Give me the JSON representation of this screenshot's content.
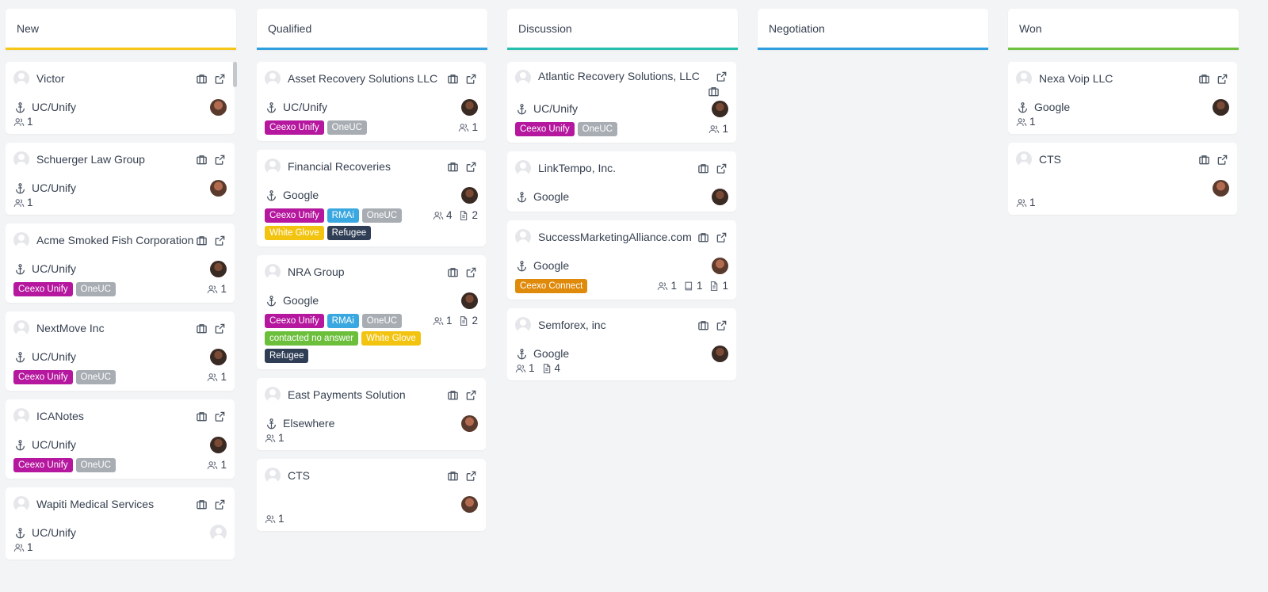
{
  "colors": {
    "new": "#f5c518",
    "qualified": "#2f9fe0",
    "discussion": "#26bfae",
    "negotiation": "#2f9fe0",
    "won": "#6fc13f"
  },
  "tag_colors": {
    "Ceexo Unify": "#b5179e",
    "OneUC": "#a8adb3",
    "RMAi": "#3aa8e0",
    "White Glove": "#f2c30f",
    "Refugee": "#2f3e55",
    "contacted no answer": "#6cbf3b",
    "Ceexo Connect": "#e08a0b"
  },
  "columns": [
    {
      "key": "new",
      "title": "New",
      "cards": [
        {
          "name": "Victor",
          "source": "UC/Unify",
          "owner": "light",
          "tags": [],
          "counts": [
            {
              "icon": "users-icon",
              "value": "1"
            }
          ],
          "counts_inline": true
        },
        {
          "name": "Schuerger Law Group",
          "source": "UC/Unify",
          "owner": "light",
          "tags": [],
          "counts": [
            {
              "icon": "users-icon",
              "value": "1"
            }
          ],
          "counts_inline": true
        },
        {
          "name": "Acme Smoked Fish Corporation",
          "source": "UC/Unify",
          "owner": "dark",
          "tags": [
            "Ceexo Unify",
            "OneUC"
          ],
          "counts": [
            {
              "icon": "users-icon",
              "value": "1"
            }
          ]
        },
        {
          "name": "NextMove Inc",
          "source": "UC/Unify",
          "owner": "dark",
          "tags": [
            "Ceexo Unify",
            "OneUC"
          ],
          "counts": [
            {
              "icon": "users-icon",
              "value": "1"
            }
          ]
        },
        {
          "name": "ICANotes",
          "source": "UC/Unify",
          "owner": "dark",
          "tags": [
            "Ceexo Unify",
            "OneUC"
          ],
          "counts": [
            {
              "icon": "users-icon",
              "value": "1"
            }
          ]
        },
        {
          "name": "Wapiti Medical Services",
          "source": "UC/Unify",
          "owner": "gray",
          "tags": [],
          "counts": [
            {
              "icon": "users-icon",
              "value": "1"
            }
          ],
          "counts_inline": true
        }
      ]
    },
    {
      "key": "qualified",
      "title": "Qualified",
      "cards": [
        {
          "name": "Asset Recovery Solutions LLC",
          "source": "UC/Unify",
          "owner": "dark",
          "tags": [
            "Ceexo Unify",
            "OneUC"
          ],
          "counts": [
            {
              "icon": "users-icon",
              "value": "1"
            }
          ]
        },
        {
          "name": "Financial Recoveries",
          "source": "Google",
          "owner": "dark",
          "tags": [
            "Ceexo Unify",
            "RMAi",
            "OneUC",
            "White Glove",
            "Refugee"
          ],
          "counts": [
            {
              "icon": "users-icon",
              "value": "4"
            },
            {
              "icon": "document-icon",
              "value": "2"
            }
          ]
        },
        {
          "name": "NRA Group",
          "source": "Google",
          "owner": "dark",
          "tags": [
            "Ceexo Unify",
            "RMAi",
            "OneUC",
            "contacted no answer",
            "White Glove",
            "Refugee"
          ],
          "counts": [
            {
              "icon": "users-icon",
              "value": "1"
            },
            {
              "icon": "document-icon",
              "value": "2"
            }
          ]
        },
        {
          "name": "East Payments Solution",
          "source": "Elsewhere",
          "owner": "light",
          "tags": [],
          "counts": [
            {
              "icon": "users-icon",
              "value": "1"
            }
          ],
          "counts_inline": true
        },
        {
          "name": "CTS",
          "source": "",
          "owner": "light",
          "tags": [],
          "counts": [
            {
              "icon": "users-icon",
              "value": "1"
            }
          ],
          "counts_inline": true
        }
      ]
    },
    {
      "key": "discussion",
      "title": "Discussion",
      "cards": [
        {
          "name": "Atlantic Recovery Solutions, LLC",
          "source": "UC/Unify",
          "owner": "dark",
          "tags": [
            "Ceexo Unify",
            "OneUC"
          ],
          "counts": [
            {
              "icon": "users-icon",
              "value": "1"
            }
          ],
          "wrap_icons": true
        },
        {
          "name": "LinkTempo, Inc.",
          "source": "Google",
          "owner": "dark",
          "tags": [],
          "counts": []
        },
        {
          "name": "SuccessMarketingAlliance.com",
          "source": "Google",
          "owner": "light",
          "tags": [
            "Ceexo Connect"
          ],
          "counts": [
            {
              "icon": "users-icon",
              "value": "1"
            },
            {
              "icon": "book-icon",
              "value": "1"
            },
            {
              "icon": "document-icon",
              "value": "1"
            }
          ]
        },
        {
          "name": "Semforex, inc",
          "source": "Google",
          "owner": "dark",
          "tags": [],
          "counts": [
            {
              "icon": "users-icon",
              "value": "1"
            },
            {
              "icon": "document-icon",
              "value": "4"
            }
          ],
          "counts_inline": true
        }
      ]
    },
    {
      "key": "negotiation",
      "title": "Negotiation",
      "cards": []
    },
    {
      "key": "won",
      "title": "Won",
      "cards": [
        {
          "name": "Nexa Voip LLC",
          "source": "Google",
          "owner": "dark",
          "tags": [],
          "counts": [
            {
              "icon": "users-icon",
              "value": "1"
            }
          ],
          "counts_inline": true
        },
        {
          "name": "CTS",
          "source": "",
          "owner": "light",
          "tags": [],
          "counts": [
            {
              "icon": "users-icon",
              "value": "1"
            }
          ],
          "counts_inline": true
        }
      ]
    }
  ]
}
